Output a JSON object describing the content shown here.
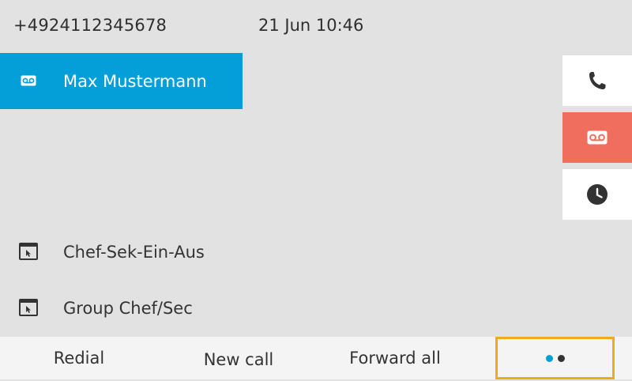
{
  "header": {
    "number": "+4924112345678",
    "datetime": "21 Jun 10:46"
  },
  "line": {
    "label": "Max Mustermann",
    "icon": "voicemail-icon",
    "selected": true
  },
  "features": [
    {
      "label": "Chef-Sek-Ein-Aus",
      "icon": "service-window-icon"
    },
    {
      "label": "Group Chef/Sec",
      "icon": "service-window-icon"
    }
  ],
  "side_buttons": [
    {
      "icon": "phone-icon",
      "label": "call"
    },
    {
      "icon": "voicemail-icon",
      "label": "voicemail",
      "active": true
    },
    {
      "icon": "clock-icon",
      "label": "recents"
    }
  ],
  "softkeys": {
    "redial": "Redial",
    "new_call": "New call",
    "forward_all": "Forward all",
    "more_icon": "more-dots-icon"
  },
  "colors": {
    "accent_blue": "#049fd9",
    "voicemail_red": "#f06e5e",
    "focus_orange": "#f2a91c",
    "background": "#e2e2e2"
  }
}
